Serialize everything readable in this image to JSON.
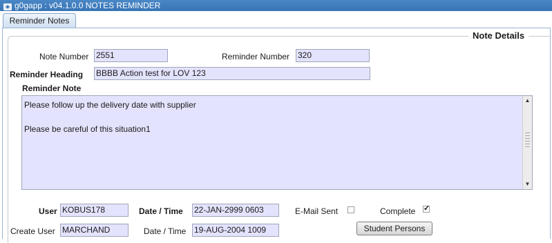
{
  "window": {
    "title": "g0gapp : v04.1.0.0 NOTES REMINDER",
    "icon": "app-window-icon"
  },
  "tabs": [
    {
      "label": "Reminder Notes",
      "active": true
    }
  ],
  "group": {
    "title": "Note Details"
  },
  "form": {
    "note_number": {
      "label": "Note Number",
      "value": "2551"
    },
    "reminder_number": {
      "label": "Reminder Number",
      "value": "320"
    },
    "reminder_heading": {
      "label": "Reminder Heading",
      "value": "BBBB Action test for LOV 123"
    },
    "reminder_note": {
      "label": "Reminder Note",
      "lines": [
        "Please follow up the delivery date with supplier",
        "Please be careful of this situation1"
      ]
    },
    "user": {
      "label": "User",
      "value": "KOBUS178"
    },
    "date_time": {
      "label": "Date / Time",
      "value": "22-JAN-2999 0603"
    },
    "email_sent": {
      "label": "E-Mail Sent",
      "checked": false
    },
    "complete": {
      "label": "Complete",
      "checked": true
    },
    "create_user": {
      "label": "Create User",
      "value": "MARCHAND"
    },
    "create_date_time": {
      "label": "Date / Time",
      "value": "19-AUG-2004 1009"
    },
    "student_persons_button": {
      "label": "Student Persons"
    }
  },
  "colors": {
    "title_bar": "#3674b6",
    "field_bg": "#e4e3fe",
    "tab_bg": "#cfe0f2"
  }
}
